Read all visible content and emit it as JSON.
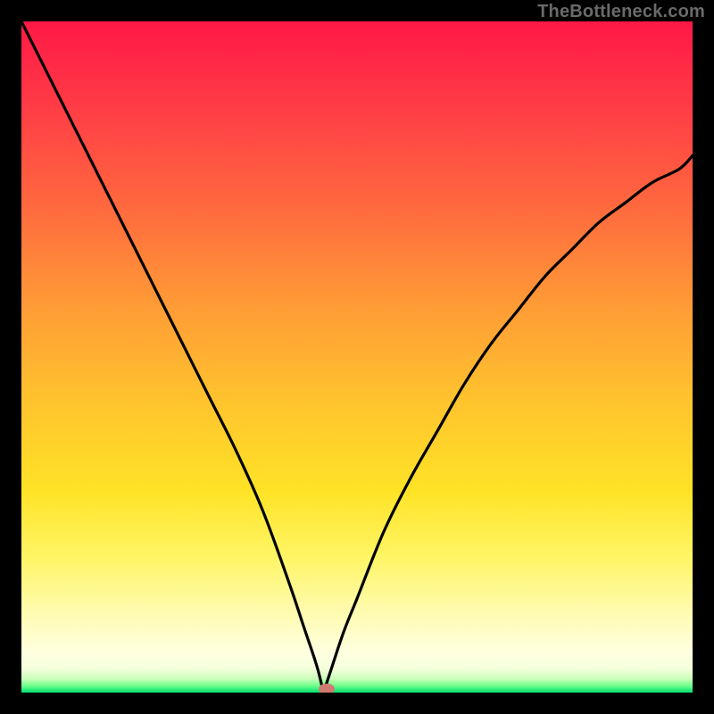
{
  "watermark": "TheBottleneck.com",
  "colors": {
    "frame_bg": "#000000",
    "curve": "#000000",
    "marker": "#cf7a72",
    "gradient_top": "#ff1846",
    "gradient_bottom": "#00e070"
  },
  "chart_data": {
    "type": "line",
    "title": "",
    "xlabel": "",
    "ylabel": "",
    "xlim": [
      0,
      100
    ],
    "ylim": [
      0,
      100
    ],
    "grid": false,
    "legend": false,
    "note": "Two visually distinct branches of a bottleneck curve meeting near the zero-line around x≈45. y-axis reads 0 (green/good) at bottom to 100 (red/bad) at top. The curve is a black line; an orange-pink marker sits at the cusp.",
    "cusp": {
      "x": 45,
      "y": 0
    },
    "series": [
      {
        "name": "left-branch",
        "x": [
          0,
          4,
          8,
          12,
          16,
          20,
          24,
          28,
          32,
          36,
          40,
          42,
          44,
          45
        ],
        "y": [
          100,
          92,
          84,
          76,
          68,
          60,
          52,
          44,
          36,
          27,
          16,
          10,
          4,
          0
        ]
      },
      {
        "name": "right-branch",
        "x": [
          45,
          46,
          48,
          50,
          54,
          58,
          62,
          66,
          70,
          74,
          78,
          82,
          86,
          90,
          94,
          98,
          100
        ],
        "y": [
          0,
          3,
          9,
          14,
          24,
          32,
          39,
          46,
          52,
          57,
          62,
          66,
          70,
          73,
          76,
          78,
          80
        ]
      }
    ],
    "marker_point": {
      "x": 45.5,
      "y": 0.5
    }
  }
}
